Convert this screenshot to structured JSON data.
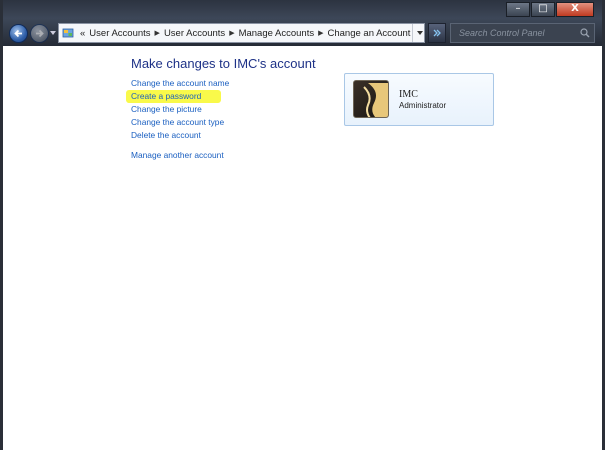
{
  "window": {
    "minimize_label": "–",
    "maximize_label": "□",
    "close_label": "X"
  },
  "address": {
    "chevrons": "«",
    "crumbs": [
      "User Accounts",
      "User Accounts",
      "Manage Accounts",
      "Change an Account"
    ],
    "separator": "▶"
  },
  "search": {
    "placeholder": "Search Control Panel"
  },
  "main": {
    "heading": "Make changes to IMC's account",
    "tasks": [
      "Change the account name",
      "Create a password",
      "Change the picture",
      "Change the account type",
      "Delete the account"
    ],
    "manage_link": "Manage another account"
  },
  "account": {
    "name": "IMC",
    "role": "Administrator"
  },
  "colors": {
    "link": "#1a5fc0",
    "heading": "#1e3287",
    "highlight": "#f9f94a"
  },
  "icons": [
    "back-arrow-icon",
    "forward-arrow-icon",
    "control-panel-icon",
    "refresh-icon",
    "search-icon",
    "user-picture-icon"
  ]
}
